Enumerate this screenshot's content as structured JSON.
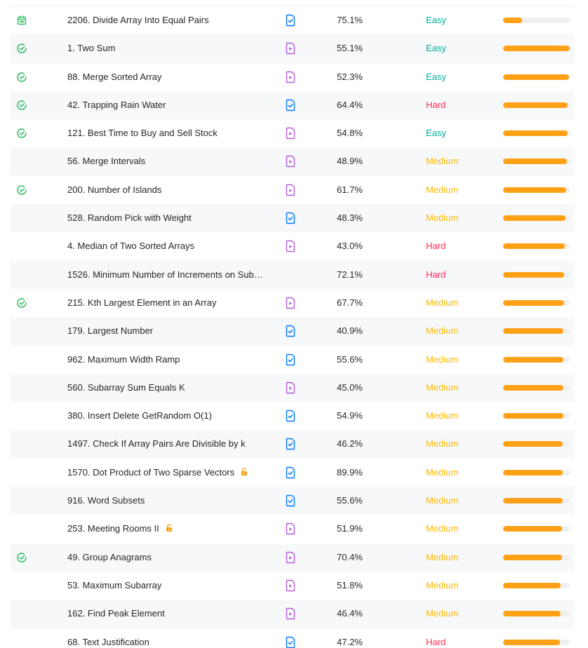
{
  "colors": {
    "easy": "#00af9b",
    "medium": "#ffb800",
    "hard": "#ff2d55",
    "frequency_bar": "#ffa116",
    "solved_check": "#2cbb5d",
    "video_solution": "#b45ad8",
    "article_solution": "#007aff",
    "premium_lock": "#ffa116"
  },
  "problems": [
    {
      "status": "daily-calendar-icon",
      "title": "2206. Divide Array Into Equal Pairs",
      "premium": false,
      "solution": "article-solution-icon",
      "acceptance": "75.1%",
      "difficulty": "Easy",
      "frequency": 0.28
    },
    {
      "status": "solved-check-icon",
      "title": "1. Two Sum",
      "premium": false,
      "solution": "video-solution-icon",
      "acceptance": "55.1%",
      "difficulty": "Easy",
      "frequency": 1.0
    },
    {
      "status": "solved-check-icon",
      "title": "88. Merge Sorted Array",
      "premium": false,
      "solution": "video-solution-icon",
      "acceptance": "52.3%",
      "difficulty": "Easy",
      "frequency": 0.99
    },
    {
      "status": "solved-check-icon",
      "title": "42. Trapping Rain Water",
      "premium": false,
      "solution": "article-solution-icon",
      "acceptance": "64.4%",
      "difficulty": "Hard",
      "frequency": 0.97
    },
    {
      "status": "solved-check-icon",
      "title": "121. Best Time to Buy and Sell Stock",
      "premium": false,
      "solution": "video-solution-icon",
      "acceptance": "54.8%",
      "difficulty": "Easy",
      "frequency": 0.97
    },
    {
      "status": "",
      "title": "56. Merge Intervals",
      "premium": false,
      "solution": "video-solution-icon",
      "acceptance": "48.9%",
      "difficulty": "Medium",
      "frequency": 0.96
    },
    {
      "status": "solved-check-icon",
      "title": "200. Number of Islands",
      "premium": false,
      "solution": "video-solution-icon",
      "acceptance": "61.7%",
      "difficulty": "Medium",
      "frequency": 0.95
    },
    {
      "status": "",
      "title": "528. Random Pick with Weight",
      "premium": false,
      "solution": "article-solution-icon",
      "acceptance": "48.3%",
      "difficulty": "Medium",
      "frequency": 0.94
    },
    {
      "status": "",
      "title": "4. Median of Two Sorted Arrays",
      "premium": false,
      "solution": "video-solution-icon",
      "acceptance": "43.0%",
      "difficulty": "Hard",
      "frequency": 0.93
    },
    {
      "status": "",
      "title": "1526. Minimum Number of Increments on Sub…",
      "premium": false,
      "solution": "",
      "acceptance": "72.1%",
      "difficulty": "Hard",
      "frequency": 0.92
    },
    {
      "status": "solved-check-icon",
      "title": "215. Kth Largest Element in an Array",
      "premium": false,
      "solution": "video-solution-icon",
      "acceptance": "67.7%",
      "difficulty": "Medium",
      "frequency": 0.92
    },
    {
      "status": "",
      "title": "179. Largest Number",
      "premium": false,
      "solution": "article-solution-icon",
      "acceptance": "40.9%",
      "difficulty": "Medium",
      "frequency": 0.91
    },
    {
      "status": "",
      "title": "962. Maximum Width Ramp",
      "premium": false,
      "solution": "article-solution-icon",
      "acceptance": "55.6%",
      "difficulty": "Medium",
      "frequency": 0.91
    },
    {
      "status": "",
      "title": "560. Subarray Sum Equals K",
      "premium": false,
      "solution": "video-solution-icon",
      "acceptance": "45.0%",
      "difficulty": "Medium",
      "frequency": 0.9
    },
    {
      "status": "",
      "title": "380. Insert Delete GetRandom O(1)",
      "premium": false,
      "solution": "article-solution-icon",
      "acceptance": "54.9%",
      "difficulty": "Medium",
      "frequency": 0.9
    },
    {
      "status": "",
      "title": "1497. Check If Array Pairs Are Divisible by k",
      "premium": false,
      "solution": "article-solution-icon",
      "acceptance": "46.2%",
      "difficulty": "Medium",
      "frequency": 0.89
    },
    {
      "status": "",
      "title": "1570. Dot Product of Two Sparse Vectors",
      "premium": true,
      "solution": "article-solution-icon",
      "acceptance": "89.9%",
      "difficulty": "Medium",
      "frequency": 0.89
    },
    {
      "status": "",
      "title": "916. Word Subsets",
      "premium": false,
      "solution": "article-solution-icon",
      "acceptance": "55.6%",
      "difficulty": "Medium",
      "frequency": 0.89
    },
    {
      "status": "",
      "title": "253. Meeting Rooms II",
      "premium": true,
      "solution": "video-solution-icon",
      "acceptance": "51.9%",
      "difficulty": "Medium",
      "frequency": 0.88
    },
    {
      "status": "solved-check-icon",
      "title": "49. Group Anagrams",
      "premium": false,
      "solution": "video-solution-icon",
      "acceptance": "70.4%",
      "difficulty": "Medium",
      "frequency": 0.88
    },
    {
      "status": "",
      "title": "53. Maximum Subarray",
      "premium": false,
      "solution": "video-solution-icon",
      "acceptance": "51.8%",
      "difficulty": "Medium",
      "frequency": 0.86
    },
    {
      "status": "",
      "title": "162. Find Peak Element",
      "premium": false,
      "solution": "video-solution-icon",
      "acceptance": "46.4%",
      "difficulty": "Medium",
      "frequency": 0.86
    },
    {
      "status": "",
      "title": "68. Text Justification",
      "premium": false,
      "solution": "article-solution-icon",
      "acceptance": "47.2%",
      "difficulty": "Hard",
      "frequency": 0.85
    }
  ]
}
